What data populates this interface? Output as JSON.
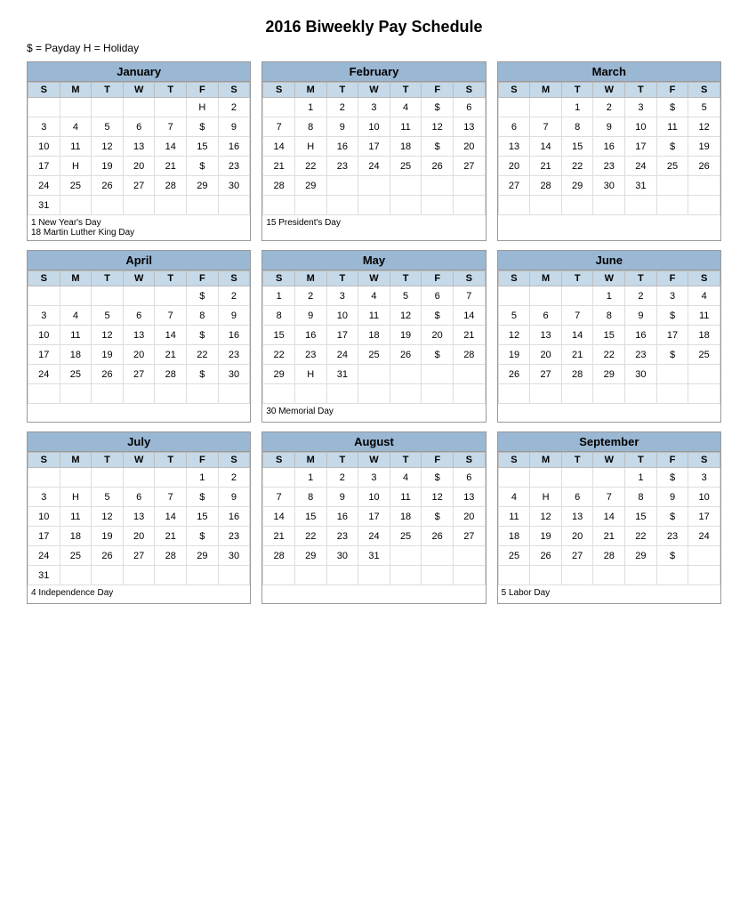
{
  "title": "2016 Biweekly Pay Schedule",
  "legend": "$ = Payday     H = Holiday",
  "months": [
    {
      "name": "January",
      "days": [
        "S",
        "M",
        "T",
        "W",
        "T",
        "F",
        "S"
      ],
      "weeks": [
        [
          "",
          "",
          "",
          "",
          "",
          "H",
          "2"
        ],
        [
          "3",
          "4",
          "5",
          "6",
          "7",
          "$",
          "9"
        ],
        [
          "10",
          "11",
          "12",
          "13",
          "14",
          "15",
          "16"
        ],
        [
          "17",
          "H",
          "19",
          "20",
          "21",
          "$",
          "23"
        ],
        [
          "24",
          "25",
          "26",
          "27",
          "28",
          "29",
          "30"
        ],
        [
          "31",
          "",
          "",
          "",
          "",
          "",
          ""
        ]
      ],
      "notes": [
        "1  New Year's Day",
        "18  Martin Luther King Day"
      ]
    },
    {
      "name": "February",
      "days": [
        "S",
        "M",
        "T",
        "W",
        "T",
        "F",
        "S"
      ],
      "weeks": [
        [
          "",
          "1",
          "2",
          "3",
          "4",
          "$",
          "6"
        ],
        [
          "7",
          "8",
          "9",
          "10",
          "11",
          "12",
          "13"
        ],
        [
          "14",
          "H",
          "16",
          "17",
          "18",
          "$",
          "20"
        ],
        [
          "21",
          "22",
          "23",
          "24",
          "25",
          "26",
          "27"
        ],
        [
          "28",
          "29",
          "",
          "",
          "",
          "",
          ""
        ],
        [
          "",
          "",
          "",
          "",
          "",
          "",
          ""
        ]
      ],
      "notes": [
        "15  President's Day"
      ]
    },
    {
      "name": "March",
      "days": [
        "S",
        "M",
        "T",
        "W",
        "T",
        "F",
        "S"
      ],
      "weeks": [
        [
          "",
          "",
          "1",
          "2",
          "3",
          "$",
          "5"
        ],
        [
          "6",
          "7",
          "8",
          "9",
          "10",
          "11",
          "12"
        ],
        [
          "13",
          "14",
          "15",
          "16",
          "17",
          "$",
          "19"
        ],
        [
          "20",
          "21",
          "22",
          "23",
          "24",
          "25",
          "26"
        ],
        [
          "27",
          "28",
          "29",
          "30",
          "31",
          "",
          ""
        ],
        [
          "",
          "",
          "",
          "",
          "",
          "",
          ""
        ]
      ],
      "notes": []
    },
    {
      "name": "April",
      "days": [
        "S",
        "M",
        "T",
        "W",
        "T",
        "F",
        "S"
      ],
      "weeks": [
        [
          "",
          "",
          "",
          "",
          "",
          "$",
          "2"
        ],
        [
          "3",
          "4",
          "5",
          "6",
          "7",
          "8",
          "9"
        ],
        [
          "10",
          "11",
          "12",
          "13",
          "14",
          "$",
          "16"
        ],
        [
          "17",
          "18",
          "19",
          "20",
          "21",
          "22",
          "23"
        ],
        [
          "24",
          "25",
          "26",
          "27",
          "28",
          "$",
          "30"
        ],
        [
          "",
          "",
          "",
          "",
          "",
          "",
          ""
        ]
      ],
      "notes": []
    },
    {
      "name": "May",
      "days": [
        "S",
        "M",
        "T",
        "W",
        "T",
        "F",
        "S"
      ],
      "weeks": [
        [
          "1",
          "2",
          "3",
          "4",
          "5",
          "6",
          "7"
        ],
        [
          "8",
          "9",
          "10",
          "11",
          "12",
          "$",
          "14"
        ],
        [
          "15",
          "16",
          "17",
          "18",
          "19",
          "20",
          "21"
        ],
        [
          "22",
          "23",
          "24",
          "25",
          "26",
          "$",
          "28"
        ],
        [
          "29",
          "H",
          "31",
          "",
          "",
          "",
          ""
        ],
        [
          "",
          "",
          "",
          "",
          "",
          "",
          ""
        ]
      ],
      "notes": [
        "30  Memorial Day"
      ]
    },
    {
      "name": "June",
      "days": [
        "S",
        "M",
        "T",
        "W",
        "T",
        "F",
        "S"
      ],
      "weeks": [
        [
          "",
          "",
          "",
          "1",
          "2",
          "3",
          "4"
        ],
        [
          "5",
          "6",
          "7",
          "8",
          "9",
          "$",
          "11"
        ],
        [
          "12",
          "13",
          "14",
          "15",
          "16",
          "17",
          "18"
        ],
        [
          "19",
          "20",
          "21",
          "22",
          "23",
          "$",
          "25"
        ],
        [
          "26",
          "27",
          "28",
          "29",
          "30",
          "",
          ""
        ],
        [
          "",
          "",
          "",
          "",
          "",
          "",
          ""
        ]
      ],
      "notes": []
    },
    {
      "name": "July",
      "days": [
        "S",
        "M",
        "T",
        "W",
        "T",
        "F",
        "S"
      ],
      "weeks": [
        [
          "",
          "",
          "",
          "",
          "",
          "1",
          "2"
        ],
        [
          "3",
          "H",
          "5",
          "6",
          "7",
          "$",
          "9"
        ],
        [
          "10",
          "11",
          "12",
          "13",
          "14",
          "15",
          "16"
        ],
        [
          "17",
          "18",
          "19",
          "20",
          "21",
          "$",
          "23"
        ],
        [
          "24",
          "25",
          "26",
          "27",
          "28",
          "29",
          "30"
        ],
        [
          "31",
          "",
          "",
          "",
          "",
          "",
          ""
        ]
      ],
      "notes": [
        "4  Independence Day"
      ]
    },
    {
      "name": "August",
      "days": [
        "S",
        "M",
        "T",
        "W",
        "T",
        "F",
        "S"
      ],
      "weeks": [
        [
          "",
          "1",
          "2",
          "3",
          "4",
          "$",
          "6"
        ],
        [
          "7",
          "8",
          "9",
          "10",
          "11",
          "12",
          "13"
        ],
        [
          "14",
          "15",
          "16",
          "17",
          "18",
          "$",
          "20"
        ],
        [
          "21",
          "22",
          "23",
          "24",
          "25",
          "26",
          "27"
        ],
        [
          "28",
          "29",
          "30",
          "31",
          "",
          "",
          ""
        ],
        [
          "",
          "",
          "",
          "",
          "",
          "",
          ""
        ]
      ],
      "notes": []
    },
    {
      "name": "September",
      "days": [
        "S",
        "M",
        "T",
        "W",
        "T",
        "F",
        "S"
      ],
      "weeks": [
        [
          "",
          "",
          "",
          "",
          "1",
          "$",
          "3"
        ],
        [
          "4",
          "H",
          "6",
          "7",
          "8",
          "9",
          "10"
        ],
        [
          "11",
          "12",
          "13",
          "14",
          "15",
          "$",
          "17"
        ],
        [
          "18",
          "19",
          "20",
          "21",
          "22",
          "23",
          "24"
        ],
        [
          "25",
          "26",
          "27",
          "28",
          "29",
          "$",
          ""
        ],
        [
          "",
          "",
          "",
          "",
          "",
          "",
          ""
        ]
      ],
      "notes": [
        "5  Labor Day"
      ]
    }
  ],
  "section_notes": {
    "jan_notes1": "1  New Year's Day",
    "jan_notes2": "18  Martin Luther King Day",
    "feb_notes": "15  President's Day",
    "may_notes": "30  Memorial Day",
    "jul_notes": "4  Independence Day",
    "sep_notes": "5  Labor Day"
  }
}
